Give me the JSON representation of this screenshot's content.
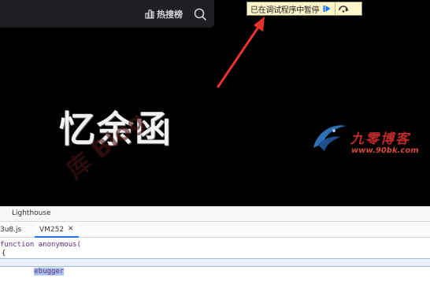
{
  "header": {
    "hot_rank_label": "热搜榜",
    "icons": [
      "hot-rank-icon",
      "search-icon"
    ]
  },
  "debugger_bar": {
    "status_text": "已在调试程序中暂停",
    "buttons": [
      "resume-icon",
      "step-over-icon"
    ],
    "colors": {
      "background": "#fbf5c9",
      "resume": "#1a73e8"
    }
  },
  "article": {
    "title": "忆余函"
  },
  "watermark": {
    "left_text": "库 Blog",
    "logo_name": "九零博客",
    "logo_url": "www.90bk.com"
  },
  "devtools": {
    "panel_tab": "Lighthouse",
    "file_tabs": [
      {
        "label": "3u8.js"
      },
      {
        "label": "VM252",
        "close_icon": "close-icon",
        "active": true
      }
    ],
    "code_lines": [
      "function anonymous(",
      "{",
      "ebugger"
    ]
  },
  "colors": {
    "annotation_arrow": "#e8322e",
    "page_background": "#000000"
  }
}
